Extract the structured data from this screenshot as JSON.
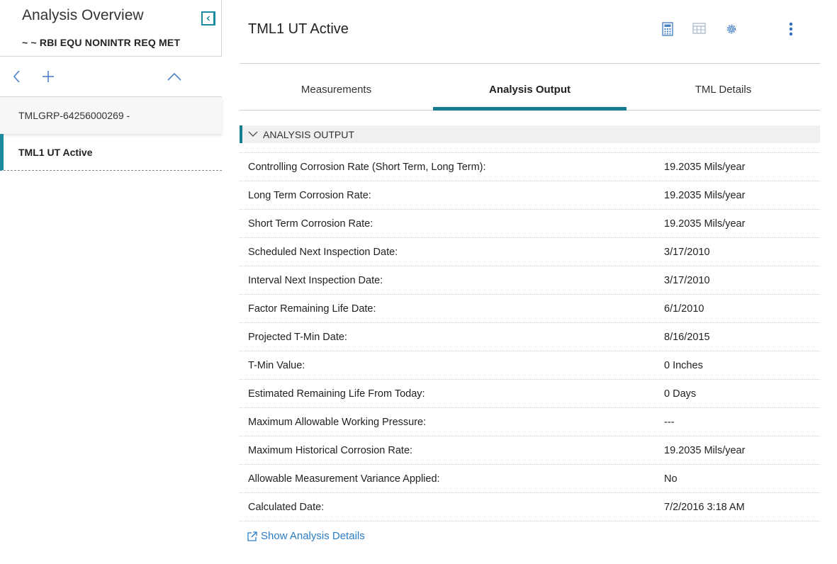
{
  "sidebar": {
    "title": "Analysis Overview",
    "subtitle": "~ ~ RBI EQU NONINTR REQ MET",
    "items": [
      {
        "label": "TMLGRP-64256000269 -"
      },
      {
        "label": "TML1 UT Active"
      }
    ]
  },
  "record": {
    "title": "TML1 UT Active"
  },
  "tabs": [
    {
      "label": "Measurements"
    },
    {
      "label": "Analysis Output"
    },
    {
      "label": "TML Details"
    }
  ],
  "section": {
    "title": "ANALYSIS OUTPUT"
  },
  "rows": [
    {
      "label": "Controlling Corrosion Rate (Short Term, Long Term):",
      "value": "19.2035 Mils/year"
    },
    {
      "label": "Long Term Corrosion Rate:",
      "value": "19.2035 Mils/year"
    },
    {
      "label": "Short Term Corrosion Rate:",
      "value": "19.2035 Mils/year"
    },
    {
      "label": "Scheduled Next Inspection Date:",
      "value": "3/17/2010"
    },
    {
      "label": "Interval Next Inspection Date:",
      "value": "3/17/2010"
    },
    {
      "label": "Factor Remaining Life Date:",
      "value": "6/1/2010"
    },
    {
      "label": "Projected T-Min Date:",
      "value": "8/16/2015"
    },
    {
      "label": "T-Min Value:",
      "value": "0 Inches"
    },
    {
      "label": "Estimated Remaining Life From Today:",
      "value": "0 Days"
    },
    {
      "label": "Maximum Allowable Working Pressure:",
      "value": "---"
    },
    {
      "label": "Maximum Historical Corrosion Rate:",
      "value": "19.2035 Mils/year"
    },
    {
      "label": "Allowable Measurement Variance Applied:",
      "value": "No"
    },
    {
      "label": "Calculated Date:",
      "value": "7/2/2016 3:18 AM"
    }
  ],
  "link": {
    "label": "Show Analysis Details"
  },
  "colors": {
    "accent": "#187c91",
    "link": "#2a7cc7",
    "icon": "#4a82c8"
  },
  "icons": [
    "collapse-panel-icon",
    "back-icon",
    "add-icon",
    "chevron-up-icon",
    "calculator-icon",
    "grid-icon",
    "gear-icon",
    "more-vertical-icon",
    "chevron-down-icon",
    "external-link-icon"
  ]
}
